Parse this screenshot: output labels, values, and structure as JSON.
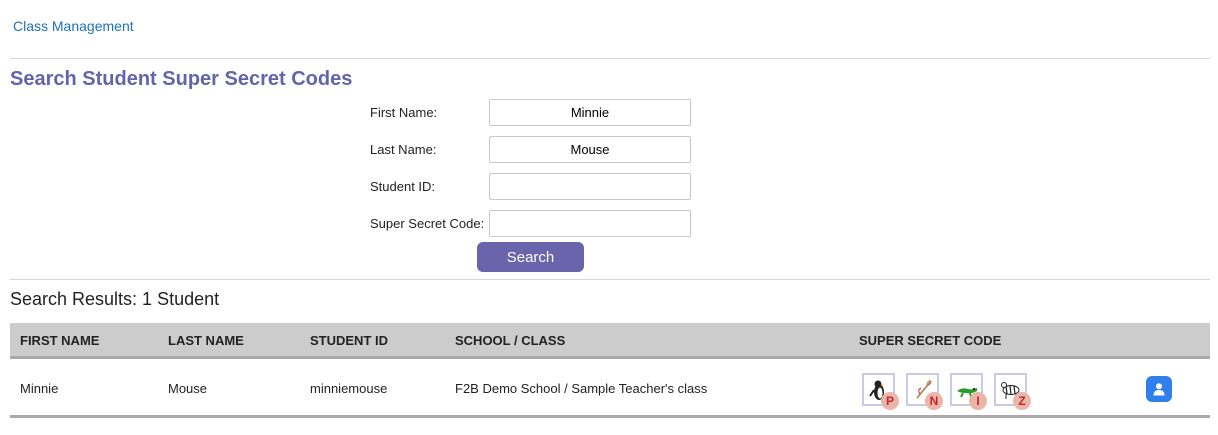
{
  "breadcrumb": {
    "label": "Class Management"
  },
  "page_title": "Search Student Super Secret Codes",
  "form": {
    "first_name": {
      "label": "First Name:",
      "value": "Minnie"
    },
    "last_name": {
      "label": "Last Name:",
      "value": "Mouse"
    },
    "student_id": {
      "label": "Student ID:",
      "value": ""
    },
    "secret_code": {
      "label": "Super Secret Code:",
      "value": ""
    },
    "search_button": "Search"
  },
  "results": {
    "title": "Search Results: 1 Student",
    "columns": [
      "FIRST NAME",
      "LAST NAME",
      "STUDENT ID",
      "SCHOOL / CLASS",
      "SUPER SECRET CODE"
    ],
    "rows": [
      {
        "first_name": "Minnie",
        "last_name": "Mouse",
        "student_id": "minniemouse",
        "school_class": "F2B Demo School / Sample Teacher's class",
        "code": [
          {
            "icon": "penguin-icon",
            "letter": "P"
          },
          {
            "icon": "needle-icon",
            "letter": "N"
          },
          {
            "icon": "iguana-icon",
            "letter": "I"
          },
          {
            "icon": "zebra-icon",
            "letter": "Z"
          }
        ]
      }
    ]
  },
  "colors": {
    "accent": "#6a64ad",
    "title": "#6464aa",
    "link": "#1a73b8",
    "profile_button": "#2f80ed",
    "badge": "#e9b6a8",
    "badge_text": "#c1272d"
  }
}
